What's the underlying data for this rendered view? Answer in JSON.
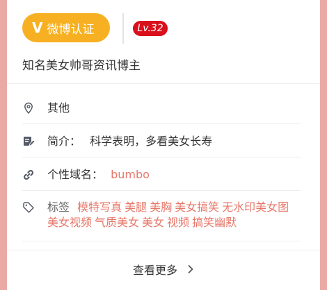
{
  "header": {
    "verify_icon": "V",
    "verify_label": "微博认证",
    "level": "Lv.32"
  },
  "bio": "知名美女帅哥资讯博主",
  "details": {
    "location": {
      "icon": "location-pin-icon",
      "value": "其他"
    },
    "intro": {
      "icon": "edit-icon",
      "label": "简介：",
      "value": "科学表明，多看美女长寿"
    },
    "domain": {
      "icon": "link-icon",
      "label": "个性域名：",
      "value": "bumbo"
    },
    "tags": {
      "icon": "tag-icon",
      "label": "标签",
      "items": [
        "模特写真",
        "美腿",
        "美胸",
        "美女搞笑",
        "无水印美女图",
        "美女视频",
        "气质美女",
        "美女",
        "视频",
        "搞笑幽默"
      ]
    }
  },
  "more": {
    "label": "查看更多",
    "icon": "chevron-right-icon"
  },
  "colors": {
    "badge_orange": "#f7b021",
    "level_red": "#d9101c",
    "link": "#e6786a",
    "background": "#e9aaa6"
  }
}
